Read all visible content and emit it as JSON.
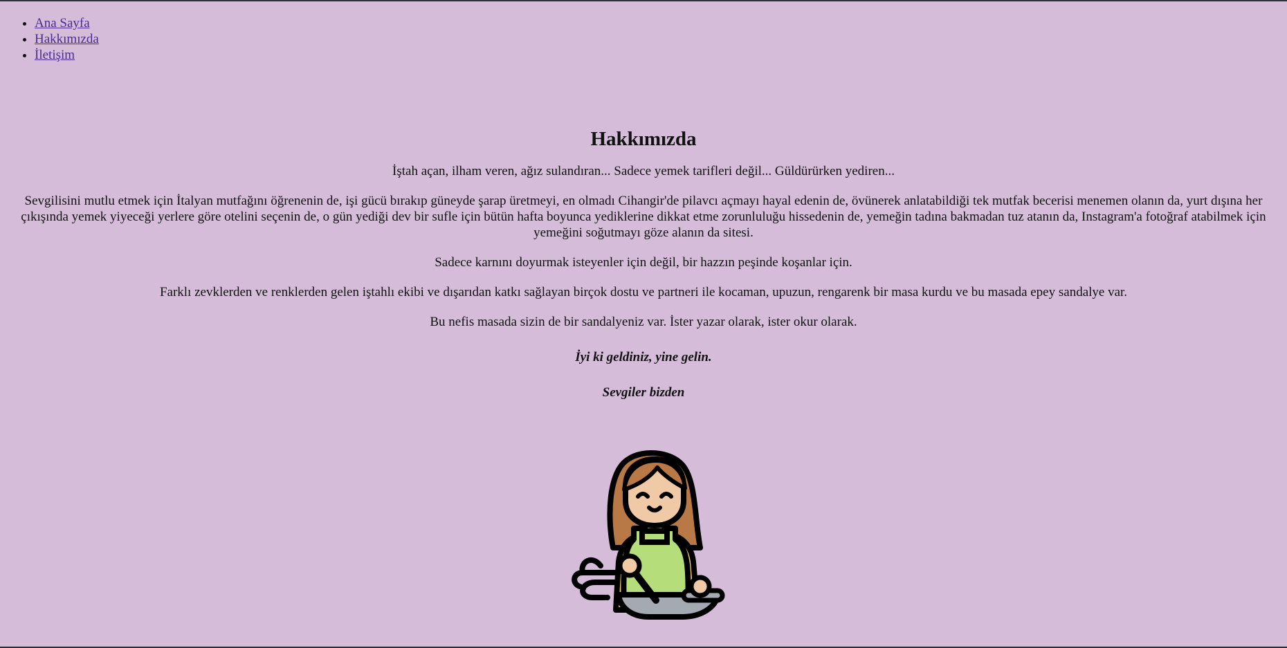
{
  "nav": {
    "items": [
      {
        "label": "Ana Sayfa"
      },
      {
        "label": "Hakkımızda"
      },
      {
        "label": "İletişim"
      }
    ]
  },
  "main": {
    "title": "Hakkımızda",
    "paragraphs": [
      "İştah açan, ilham veren, ağız sulandıran... Sadece yemek tarifleri değil... Güldürürken yediren...",
      "Sevgilisini mutlu etmek için İtalyan mutfağını öğrenenin de, işi gücü bırakıp güneyde şarap üretmeyi, en olmadı Cihangir'de pilavcı açmayı hayal edenin de, övünerek anlatabildiği tek mutfak becerisi menemen olanın da, yurt dışına her çıkışında yemek yiyeceği yerlere göre otelini seçenin de, o gün yediği dev bir sufle için bütün hafta boyunca yediklerine dikkat etme zorunluluğu hissedenin de, yemeğin tadına bakmadan tuz atanın da, Instagram'a fotoğraf atabilmek için yemeğini soğutmayı göze alanın da sitesi.",
      "Sadece karnını doyurmak isteyenler için değil, bir hazzın peşinde koşanlar için.",
      "Farklı zevklerden ve renklerden gelen iştahlı ekibi ve dışarıdan katkı sağlayan birçok dostu ve partneri ile kocaman, upuzun, rengarenk bir masa kurdu ve bu masada epey sandalye var.",
      "Bu nefis masada sizin de bir sandalyeniz var. İster yazar olarak, ister okur olarak."
    ],
    "emphasis": [
      "İyi ki geldiniz, yine gelin.",
      "Sevgiler bizden"
    ]
  },
  "illustration": {
    "icon": "chef-woman-cooking-icon",
    "colors": {
      "hair": "#b87947",
      "skin": "#f0c9a6",
      "apron": "#b5de7a",
      "shirt": "#f2cd6b",
      "pan": "#a4a9b2",
      "outline": "#000000"
    }
  }
}
